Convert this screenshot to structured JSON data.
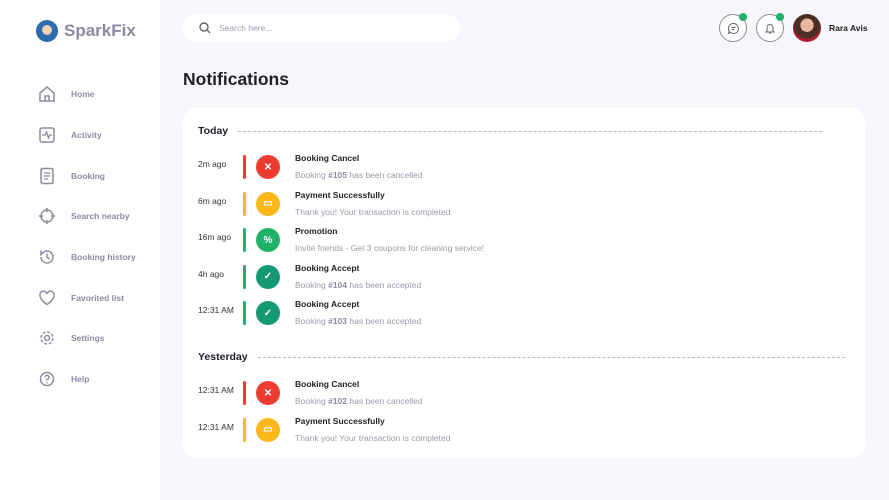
{
  "app": {
    "name": "SparkFix"
  },
  "sidebar": {
    "items": [
      {
        "label": "Home",
        "icon": "home-icon"
      },
      {
        "label": "Activity",
        "icon": "activity-icon"
      },
      {
        "label": "Booking",
        "icon": "document-icon"
      },
      {
        "label": "Search nearby",
        "icon": "crosshair-icon"
      },
      {
        "label": "Booking history",
        "icon": "history-icon"
      },
      {
        "label": "Favorited list",
        "icon": "heart-icon"
      },
      {
        "label": "Settings",
        "icon": "gear-icon"
      },
      {
        "label": "Help",
        "icon": "help-icon"
      }
    ]
  },
  "header": {
    "search_placeholder": "Search here...",
    "user_name": "Rara Avis"
  },
  "page": {
    "title": "Notifications"
  },
  "colors": {
    "red": "#ee3b2f",
    "yellow": "#fbb81b",
    "green": "#20b26b",
    "teal": "#139a72"
  },
  "sections": [
    {
      "label": "Today",
      "items": [
        {
          "time": "2m ago",
          "title": "Booking Cancel",
          "pre": "Booking ",
          "bold": "#105",
          "post": " has been cancelled",
          "type": "cancel"
        },
        {
          "time": "6m ago",
          "title": "Payment Successfully",
          "pre": "Thank you! Your transaction is completed",
          "bold": "",
          "post": "",
          "type": "payment"
        },
        {
          "time": "16m ago",
          "title": "Promotion",
          "pre": "Invite friends - Get 3 coupons for cleaning service!",
          "bold": "",
          "post": "",
          "type": "promo"
        },
        {
          "time": "4h ago",
          "title": "Booking Accept",
          "pre": "Booking ",
          "bold": "#104",
          "post": " has been accepted",
          "type": "accept"
        },
        {
          "time": "12:31 AM",
          "title": "Booking Accept",
          "pre": "Booking ",
          "bold": "#103",
          "post": " has been accepted",
          "type": "accept"
        }
      ]
    },
    {
      "label": "Yesterday",
      "items": [
        {
          "time": "12:31 AM",
          "title": "Booking Cancel",
          "pre": "Booking ",
          "bold": "#102",
          "post": " has been cancelled",
          "type": "cancel"
        },
        {
          "time": "12:31 AM",
          "title": "Payment Successfully",
          "pre": "Thank you! Your transaction is completed",
          "bold": "",
          "post": "",
          "type": "payment"
        }
      ]
    }
  ]
}
